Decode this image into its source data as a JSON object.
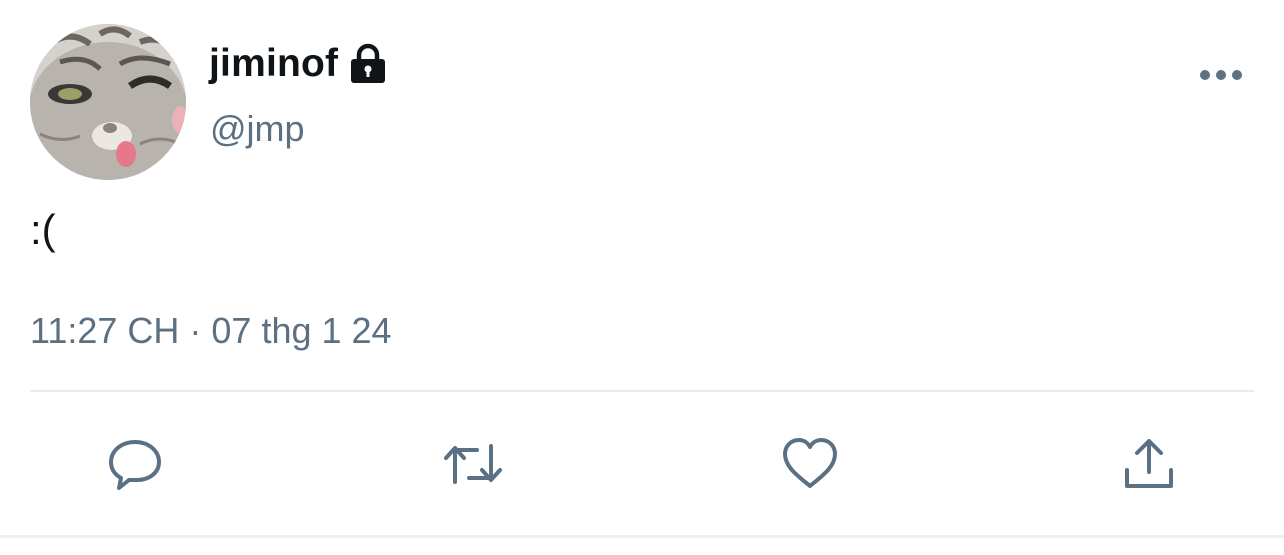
{
  "tweet": {
    "display_name": "jiminof",
    "protected_icon": "lock-icon",
    "handle": "@jmp",
    "text": ":(",
    "timestamp": "11:27 CH · 07 thg 1 24"
  },
  "actions": [
    {
      "name": "reply",
      "icon": "speech-bubble-icon"
    },
    {
      "name": "retweet",
      "icon": "retweet-arrows-icon"
    },
    {
      "name": "like",
      "icon": "heart-icon"
    },
    {
      "name": "share",
      "icon": "share-upload-icon"
    }
  ],
  "menu": {
    "icon": "more-dots-icon"
  },
  "colors": {
    "text_primary": "#0f1419",
    "text_secondary": "#5b7083",
    "icon": "#5b7083",
    "divider": "#e6ecf0",
    "background": "#ffffff"
  }
}
